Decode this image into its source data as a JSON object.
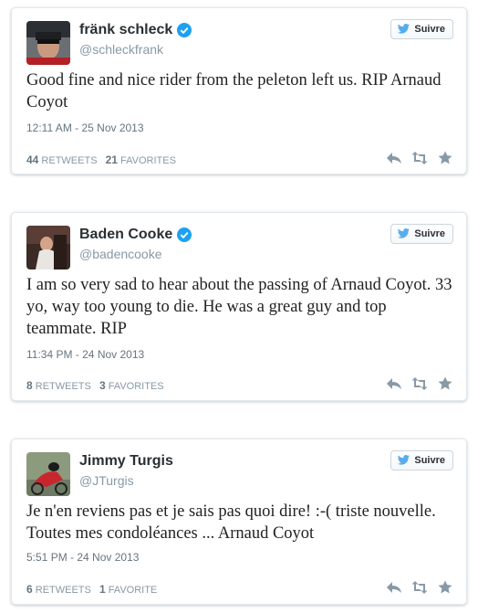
{
  "tweets": [
    {
      "name": "fränk schleck",
      "handle": "@schleckfrank",
      "verified": true,
      "follow_label": "Suivre",
      "text": "Good fine and nice rider from the peleton left us. RIP Arnaud Coyot",
      "date": "12:11 AM - 25 Nov 2013",
      "retweets_count": "44",
      "retweets_label": "RETWEETS",
      "favorites_count": "21",
      "favorites_label": "FAVORITES"
    },
    {
      "name": "Baden Cooke",
      "handle": "@badencooke",
      "verified": true,
      "follow_label": "Suivre",
      "text": "I am so very sad to hear about the passing of Arnaud Coyot. 33 yo, way too young to die. He was a great guy and top teammate. RIP",
      "date": "11:34 PM - 24 Nov 2013",
      "retweets_count": "8",
      "retweets_label": "RETWEETS",
      "favorites_count": "3",
      "favorites_label": "FAVORITES"
    },
    {
      "name": "Jimmy Turgis",
      "handle": "@JTurgis",
      "verified": false,
      "follow_label": "Suivre",
      "text": "Je n'en reviens pas et je sais pas quoi dire! :-( triste nouvelle. Toutes mes condoléances ... Arnaud Coyot",
      "date": "5:51 PM - 24 Nov 2013",
      "retweets_count": "6",
      "retweets_label": "RETWEETS",
      "favorites_count": "1",
      "favorites_label": "FAVORITE"
    }
  ],
  "colors": {
    "verified": "#1da1f2",
    "bird": "#55acee",
    "action_icon": "#8899a6",
    "border": "#e1e8ed"
  },
  "icons": [
    "verified-badge-icon",
    "twitter-bird-icon",
    "reply-icon",
    "retweet-icon",
    "favorite-star-icon"
  ]
}
